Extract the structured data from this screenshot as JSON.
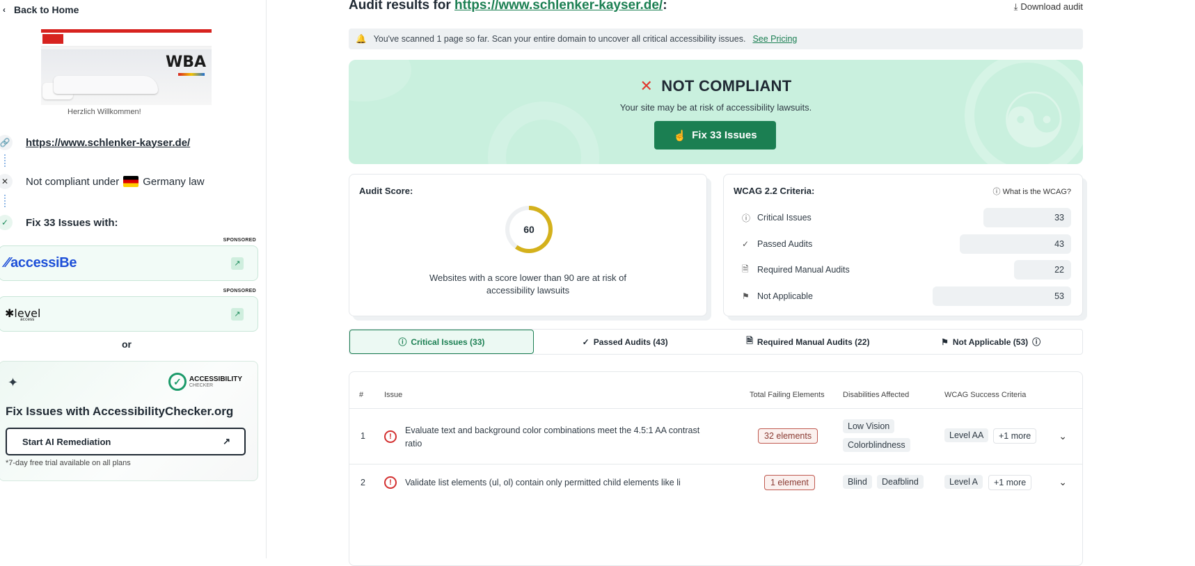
{
  "sidebar": {
    "back_label": "Back to Home",
    "thumbnail": {
      "brand": "WBA",
      "welcome": "Herzlich Willkommen!"
    },
    "url": "https://www.schlenker-kayser.de/",
    "compliance_prefix": "Not compliant under",
    "compliance_law": "Germany law",
    "fix_with": "Fix 33 Issues with:",
    "sponsored_label": "SPONSORED",
    "partners": [
      {
        "name": "accessiBe"
      },
      {
        "name": "level",
        "sub": "access"
      }
    ],
    "or_label": "or",
    "ac_card": {
      "logo_line1": "ACCESSIBILITY",
      "logo_line2": "CHECKER",
      "title": "Fix Issues with AccessibilityChecker.org",
      "button": "Start AI Remediation",
      "note": "*7-day free trial available on all plans"
    }
  },
  "main": {
    "title_prefix": "Audit results for",
    "title_url": "https://www.schlenker-kayser.de/",
    "title_suffix": ":",
    "download": "Download audit",
    "notice_text": "You've scanned 1 page so far. Scan your entire domain to uncover all critical accessibility issues.",
    "notice_link": "See Pricing",
    "status": {
      "headline": "NOT COMPLIANT",
      "subtext": "Your site may be at risk of accessibility lawsuits.",
      "button": "Fix 33 Issues"
    },
    "score_card": {
      "label": "Audit Score:",
      "score": "60",
      "score_fraction": 0.6,
      "score_color": "#d4b11c",
      "description": "Websites with a score lower than 90 are at risk of accessibility lawsuits"
    },
    "wcag_card": {
      "label": "WCAG 2.2 Criteria:",
      "help": "What is the WCAG?",
      "rows": [
        {
          "icon": "alert-circle-icon",
          "label": "Critical Issues",
          "value": "33"
        },
        {
          "icon": "check-icon",
          "label": "Passed Audits",
          "value": "43"
        },
        {
          "icon": "document-icon",
          "label": "Required Manual Audits",
          "value": "22"
        },
        {
          "icon": "flag-icon",
          "label": "Not Applicable",
          "value": "53"
        }
      ]
    },
    "tabs": [
      {
        "label": "Critical Issues (33)",
        "active": true
      },
      {
        "label": "Passed Audits (43)"
      },
      {
        "label": "Required Manual Audits (22)"
      },
      {
        "label": "Not Applicable (53)"
      }
    ],
    "table": {
      "headers": [
        "#",
        "Issue",
        "Total Failing Elements",
        "Disabilities Affected",
        "WCAG Success Criteria"
      ],
      "rows": [
        {
          "num": "1",
          "issue_line1": "Evaluate text and background color combinations meet the 4.5:1 AA contrast",
          "issue_line2": "ratio",
          "elements": "32 elements",
          "disabilities": [
            "Low Vision",
            "Colorblindness"
          ],
          "level": "Level AA",
          "more": "+1 more"
        },
        {
          "num": "2",
          "issue_line1": "Validate list elements (ul, ol) contain only permitted child elements like li",
          "elements": "1 element",
          "disabilities": [
            "Blind",
            "Deafblind"
          ],
          "level": "Level A",
          "more": "+1 more"
        }
      ]
    }
  },
  "colors": {
    "brand_green": "#1b7f52",
    "status_bg": "#c9f0de",
    "error_red": "#e0382e"
  }
}
